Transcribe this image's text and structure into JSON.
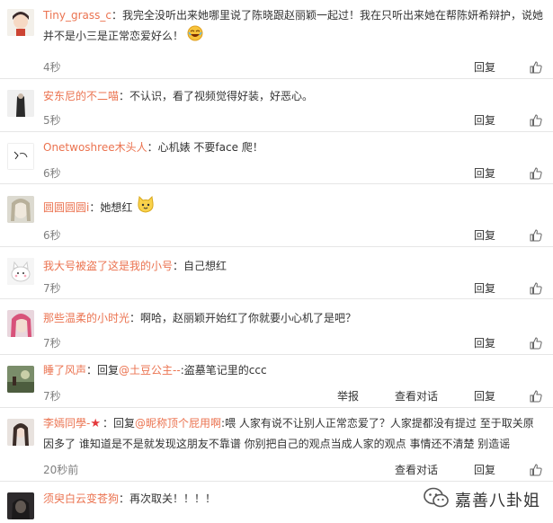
{
  "comments": [
    {
      "user": "Tiny_grass_c",
      "text": "：我完全没听出来她哪里说了陈晓跟赵丽颖一起过！我在只听出来她在帮陈妍希辩护，说她并不是小三是正常恋爱好么！",
      "time": "4秒",
      "reply": "回复",
      "avatar": "cartoon-girl"
    },
    {
      "user": "安东尼的不二喵",
      "text": "：不认识，看了视频觉得好装，好恶心。",
      "time": "5秒",
      "reply": "回复",
      "avatar": "dark-figure"
    },
    {
      "user": "Onetwoshree木头人",
      "text": "：心机婊 不要face 爬！",
      "time": "6秒",
      "reply": "回复",
      "avatar": "white-sketch"
    },
    {
      "user": "圆圆圆圆i",
      "text": "：她想红",
      "time": "6秒",
      "reply": "回复",
      "avatar": "pale-face"
    },
    {
      "user": "我大号被盗了这是我的小号",
      "text": "：自己想红",
      "time": "7秒",
      "reply": "回复",
      "avatar": "white-cat"
    },
    {
      "user": "那些温柔的小时光",
      "text": "：啊哈，赵丽颖开始红了你就要小心机了是吧？",
      "time": "7秒",
      "reply": "回复",
      "avatar": "pink-hair"
    },
    {
      "user": "睡了风声",
      "text_prefix": "：回复",
      "mention": "@土豆公主--",
      "text": ":盗墓笔记里的ccc",
      "time": "7秒",
      "report": "举报",
      "conversation": "查看对话",
      "reply": "回复",
      "avatar": "green-scene"
    },
    {
      "user": "李嫣同學-",
      "text_prefix": "：回复",
      "mention": "@昵称顶个屁用啊",
      "text": ":喂 人家有说不让别人正常恋爱了？人家提都没有提过 至于取关原因多了 谁知道是不是就发现这朋友不靠谱 你别把自己的观点当成人家的观点 事情还不清楚 别造谣",
      "time": "20秒前",
      "conversation": "查看对话",
      "reply": "回复",
      "avatar": "girl-portrait"
    },
    {
      "user": "须臾白云变苍狗",
      "text": "：再次取关！！！！",
      "avatar": "dark-portrait"
    }
  ],
  "watermark": {
    "text": "嘉善八卦姐"
  },
  "icons": {
    "like": "thumbs-up-icon",
    "laugh": "laughing-emoji-icon",
    "cat": "cat-emoji-icon"
  }
}
